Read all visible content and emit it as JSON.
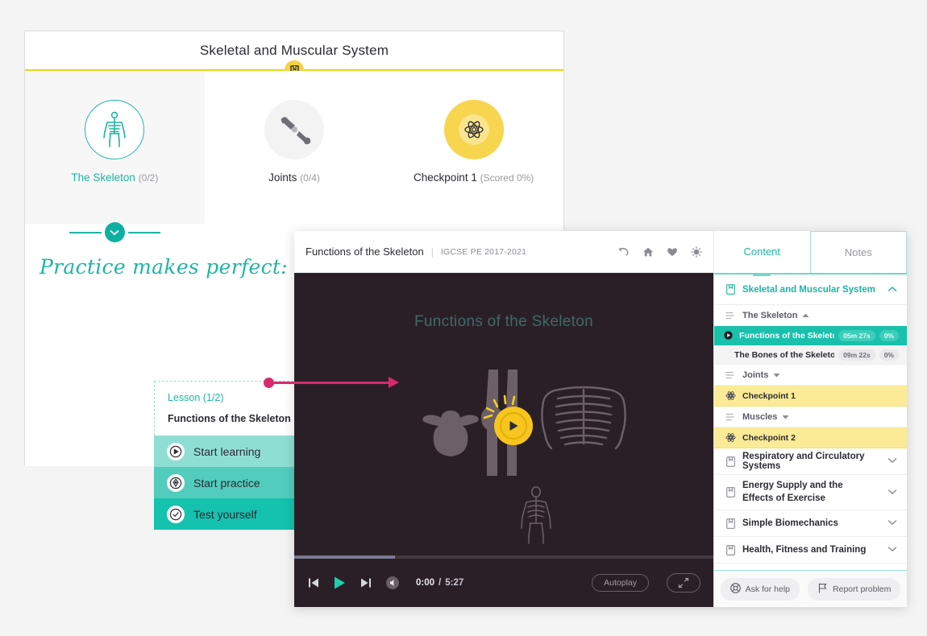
{
  "course": {
    "title": "Skeletal and Muscular System",
    "bookmark_icon": "bookmark-icon",
    "nodes": [
      {
        "label": "The Skeleton",
        "progress": "(0/2)",
        "icon": "skeleton-icon",
        "state": "active"
      },
      {
        "label": "Joints",
        "progress": "(0/4)",
        "icon": "joint-bones-icon",
        "state": "default"
      },
      {
        "label": "Checkpoint 1",
        "progress": "(Scored 0%)",
        "icon": "atom-icon",
        "state": "checkpoint"
      }
    ],
    "collapse_icon": "chevron-down-icon",
    "practice_heading": "Practice makes perfect:",
    "practice_input_placeholder": "Start practice",
    "lesson": {
      "kicker": "Lesson (1/2)",
      "name": "Functions of the Skeleton",
      "actions": [
        {
          "label": "Start learning",
          "icon": "play-circle-icon"
        },
        {
          "label": "Start practice",
          "icon": "target-circle-icon"
        },
        {
          "label": "Test yourself",
          "icon": "check-circle-icon"
        }
      ]
    }
  },
  "player": {
    "header": {
      "title": "Functions of the Skeleton",
      "separator": "|",
      "course_code": "IGCSE PE 2017-2021",
      "icons": [
        "undo-icon",
        "home-icon",
        "heart-icon",
        "brightness-icon"
      ]
    },
    "stage": {
      "heading": "Functions of the Skeleton",
      "play_icon": "play-icon",
      "images": [
        "vertebra-bone-image",
        "knee-joint-image",
        "ribcage-image",
        "full-skeleton-image"
      ]
    },
    "controls": {
      "prev_icon": "skip-previous-icon",
      "play_icon": "play-icon",
      "next_icon": "skip-next-icon",
      "volume_icon": "volume-icon",
      "current_time": "0:00",
      "time_separator": "/",
      "total_time": "5:27",
      "autoplay_label": "Autoplay",
      "fullscreen_icon": "fullscreen-icon",
      "progress_percent": 24
    }
  },
  "sidebar": {
    "tabs": [
      {
        "label": "Content",
        "active": true
      },
      {
        "label": "Notes",
        "active": false
      }
    ],
    "sections": [
      {
        "type": "section",
        "label": "Skeletal and Muscular System",
        "icon": "book-icon",
        "chevron": "chevron-up-icon",
        "open": true
      },
      {
        "type": "group",
        "label": "The Skeleton",
        "icon": "list-icon",
        "chevron": "caret-up-icon"
      },
      {
        "type": "item",
        "label": "Functions of the Skeleton",
        "duration": "05m 27s",
        "score": "0%",
        "active": true,
        "icon": "play-dot-icon"
      },
      {
        "type": "item",
        "label": "The Bones of the Skeleton",
        "duration": "09m 22s",
        "score": "0%",
        "active": false,
        "shaded": true
      },
      {
        "type": "group",
        "label": "Joints",
        "icon": "list-icon",
        "chevron": "caret-down-icon"
      },
      {
        "type": "checkpoint",
        "label": "Checkpoint 1",
        "icon": "atom-icon"
      },
      {
        "type": "group",
        "label": "Muscles",
        "icon": "list-icon",
        "chevron": "caret-down-icon"
      },
      {
        "type": "checkpoint",
        "label": "Checkpoint 2",
        "icon": "atom-icon"
      },
      {
        "type": "section",
        "label": "Respiratory and Circulatory Systems",
        "icon": "book-icon",
        "chevron": "chevron-down-icon",
        "open": false
      },
      {
        "type": "section",
        "label": "Energy Supply and the Effects of Exercise",
        "icon": "book-icon",
        "chevron": "chevron-down-icon",
        "open": false,
        "tall": true
      },
      {
        "type": "section",
        "label": "Simple Biomechanics",
        "icon": "book-icon",
        "chevron": "chevron-down-icon",
        "open": false
      },
      {
        "type": "section",
        "label": "Health, Fitness and Training",
        "icon": "book-icon",
        "chevron": "chevron-down-icon",
        "open": false
      }
    ],
    "footer": [
      {
        "label": "Ask for help",
        "icon": "lifebuoy-icon"
      },
      {
        "label": "Report problem",
        "icon": "flag-icon"
      }
    ]
  },
  "colors": {
    "teal": "#1fb5a4",
    "teal_active": "#19c0ab",
    "yellow": "#f7d54e",
    "yellow_divider": "#f3d214",
    "checkpoint_bg": "#fbeb96",
    "pink_pointer": "#d62a6e",
    "video_bg": "#2b1f27",
    "page_bg": "#f4f4f4"
  }
}
